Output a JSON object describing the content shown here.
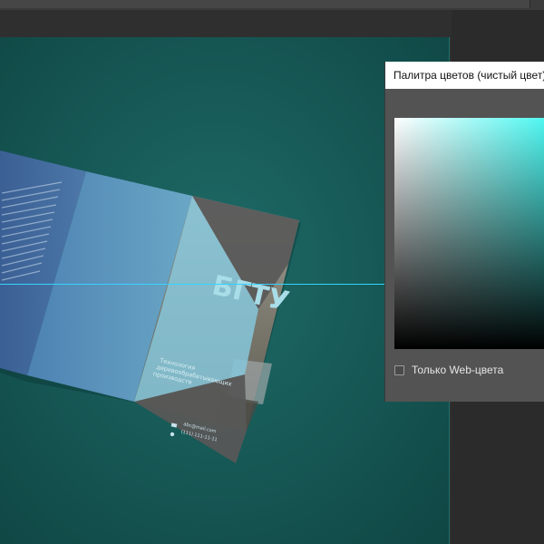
{
  "color_picker": {
    "title": "Палитра цветов (чистый цвет)",
    "web_colors_only_label": "Только Web-цвета",
    "web_colors_only_checked": false,
    "hue_color": "#4ff7f1"
  },
  "canvas": {
    "background_color": "#175a57",
    "guide_color": "#35d3ff"
  },
  "brochure": {
    "logo": "БГТУ",
    "tagline_line1": "Технология",
    "tagline_line2": "деревообрабатывающих",
    "tagline_line3": "производств",
    "email": "abc@mail.com",
    "phone": "(111) 111-11-11"
  }
}
